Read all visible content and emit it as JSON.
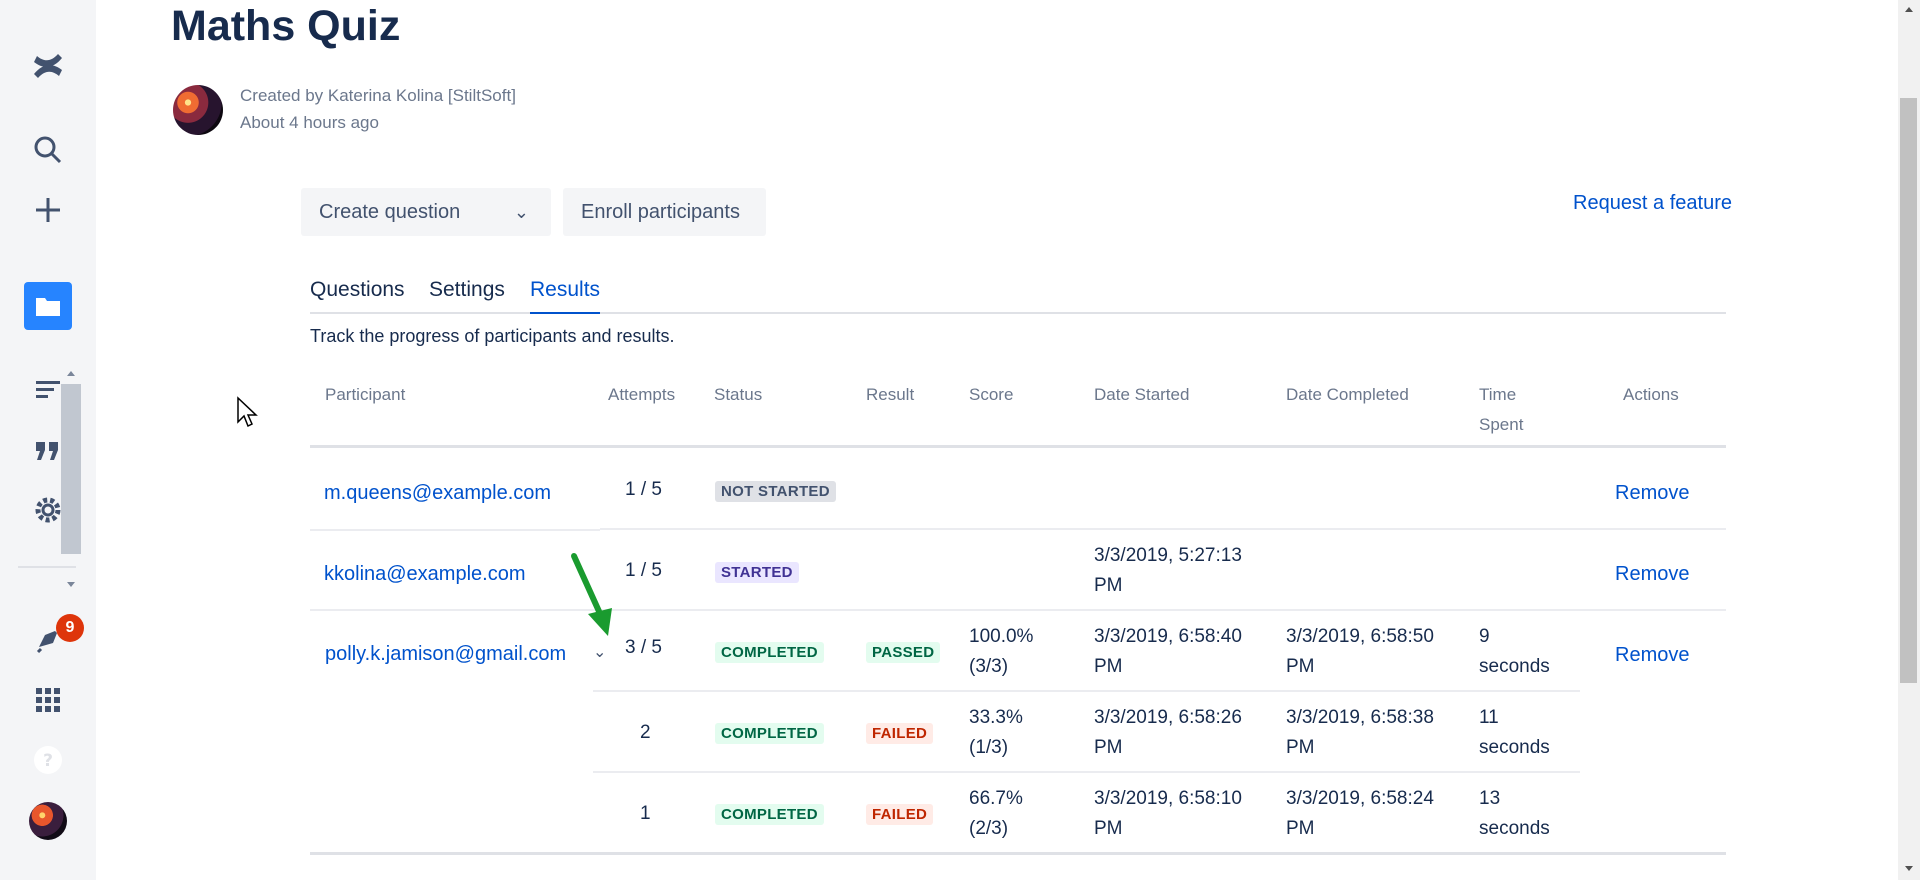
{
  "page": {
    "title": "Maths Quiz",
    "author_line": "Created by Katerina Kolina [StiltSoft]",
    "time_line": "About 4 hours ago"
  },
  "sidebar": {
    "notification_count": "9",
    "icons": [
      "confluence-logo-icon",
      "search-icon",
      "create-icon",
      "spaces-icon",
      "recent-icon",
      "quote-icon",
      "settings-icon",
      "notifications-icon",
      "app-switcher-icon",
      "help-icon",
      "profile-avatar"
    ]
  },
  "toolbar": {
    "create_question": "Create question",
    "enroll_participants": "Enroll participants",
    "request_feature": "Request a feature"
  },
  "tabs": {
    "questions": "Questions",
    "settings": "Settings",
    "results": "Results",
    "active": "Results"
  },
  "results": {
    "subtitle": "Track the progress of participants and results.",
    "columns": {
      "participant": "Participant",
      "attempts": "Attempts",
      "status": "Status",
      "result": "Result",
      "score": "Score",
      "date_started": "Date Started",
      "date_completed": "Date Completed",
      "time_spent_1": "Time",
      "time_spent_2": "Spent",
      "actions": "Actions"
    },
    "rows": [
      {
        "participant": "m.queens@example.com",
        "attempts": "1 / 5",
        "status": "NOT STARTED",
        "action": "Remove"
      },
      {
        "participant": "kkolina@example.com",
        "attempts": "1 / 5",
        "status": "STARTED",
        "date_started_1": "3/3/2019, 5:27:13",
        "date_started_2": "PM",
        "action": "Remove"
      },
      {
        "participant": "polly.k.jamison@gmail.com",
        "attempts": "3 / 5",
        "status": "COMPLETED",
        "result": "PASSED",
        "score_1": "100.0%",
        "score_2": "(3/3)",
        "date_started_1": "3/3/2019, 6:58:40",
        "date_started_2": "PM",
        "date_completed_1": "3/3/2019, 6:58:50",
        "date_completed_2": "PM",
        "time_1": "9",
        "time_2": "seconds",
        "action": "Remove"
      }
    ],
    "sub_attempts": [
      {
        "attempt": "2",
        "status": "COMPLETED",
        "result": "FAILED",
        "score_1": "33.3%",
        "score_2": "(1/3)",
        "date_started_1": "3/3/2019, 6:58:26",
        "date_started_2": "PM",
        "date_completed_1": "3/3/2019, 6:58:38",
        "date_completed_2": "PM",
        "time_1": "11",
        "time_2": "seconds"
      },
      {
        "attempt": "1",
        "status": "COMPLETED",
        "result": "FAILED",
        "score_1": "66.7%",
        "score_2": "(2/3)",
        "date_started_1": "3/3/2019, 6:58:10",
        "date_started_2": "PM",
        "date_completed_1": "3/3/2019, 6:58:24",
        "date_completed_2": "PM",
        "time_1": "13",
        "time_2": "seconds"
      }
    ]
  },
  "colors": {
    "accent": "#0052cc",
    "annotation_arrow": "#1a9b2f"
  }
}
